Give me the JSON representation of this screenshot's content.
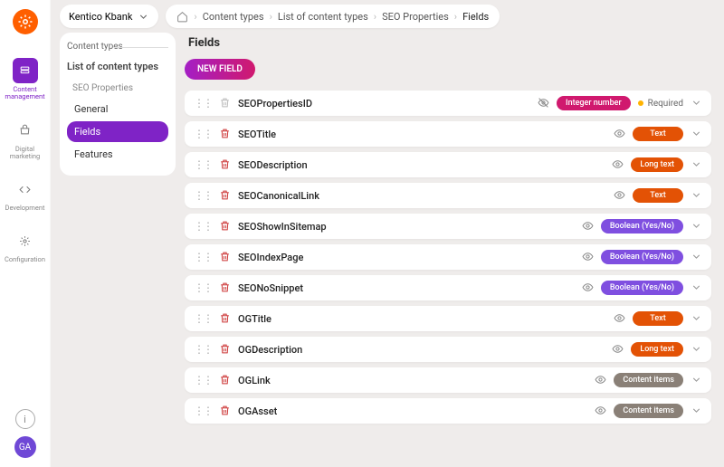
{
  "project": {
    "name": "Kentico Kbank"
  },
  "breadcrumbs": {
    "items": [
      "Content types",
      "List of content types",
      "SEO Properties",
      "Fields"
    ]
  },
  "leftnav": {
    "items": [
      {
        "label": "Content management",
        "icon": "layers-icon",
        "active": true
      },
      {
        "label": "Digital marketing",
        "icon": "shop-icon"
      },
      {
        "label": "Development",
        "icon": "code-icon"
      },
      {
        "label": "Configuration",
        "icon": "gear-icon"
      }
    ],
    "avatar_initials": "GA"
  },
  "sidebar": {
    "category": "Content types",
    "title": "List of content types",
    "subtype": "SEO Properties",
    "items": [
      {
        "label": "General",
        "active": false
      },
      {
        "label": "Fields",
        "active": true
      },
      {
        "label": "Features",
        "active": false
      }
    ]
  },
  "page": {
    "title": "Fields",
    "new_button": "NEW FIELD"
  },
  "datatypes": {
    "integer": {
      "label": "Integer number",
      "color": "#d0196e"
    },
    "text": {
      "label": "Text",
      "color": "#e35205"
    },
    "longtext": {
      "label": "Long text",
      "color": "#e35205"
    },
    "boolean": {
      "label": "Boolean (Yes/No)",
      "color": "#7f4fe0"
    },
    "content": {
      "label": "Content items",
      "color": "#8a8077"
    }
  },
  "required_label": "Required",
  "fields": [
    {
      "name": "SEOPropertiesID",
      "type": "integer",
      "deletable": false,
      "visibility": "hidden",
      "required": true
    },
    {
      "name": "SEOTitle",
      "type": "text",
      "deletable": true,
      "visibility": "visible"
    },
    {
      "name": "SEODescription",
      "type": "longtext",
      "deletable": true,
      "visibility": "visible"
    },
    {
      "name": "SEOCanonicalLink",
      "type": "text",
      "deletable": true,
      "visibility": "visible"
    },
    {
      "name": "SEOShowInSitemap",
      "type": "boolean",
      "deletable": true,
      "visibility": "visible"
    },
    {
      "name": "SEOIndexPage",
      "type": "boolean",
      "deletable": true,
      "visibility": "visible"
    },
    {
      "name": "SEONoSnippet",
      "type": "boolean",
      "deletable": true,
      "visibility": "visible"
    },
    {
      "name": "OGTitle",
      "type": "text",
      "deletable": true,
      "visibility": "visible"
    },
    {
      "name": "OGDescription",
      "type": "longtext",
      "deletable": true,
      "visibility": "visible"
    },
    {
      "name": "OGLink",
      "type": "content",
      "deletable": true,
      "visibility": "visible"
    },
    {
      "name": "OGAsset",
      "type": "content",
      "deletable": true,
      "visibility": "visible"
    }
  ]
}
